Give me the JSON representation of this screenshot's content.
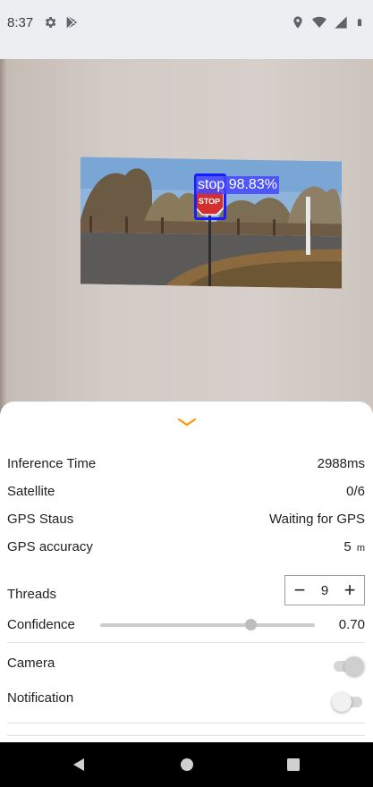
{
  "status_bar": {
    "time": "8:37",
    "left_icons": [
      "settings-icon",
      "play-store-icon"
    ],
    "right_icons": [
      "location-icon",
      "wifi-icon",
      "signal-icon",
      "battery-icon"
    ]
  },
  "camera": {
    "detection": {
      "label": "stop 98.83%",
      "color": "#1a1aff"
    },
    "sign_text": "STOP"
  },
  "sheet": {
    "collapse_icon": "chevron-down-icon",
    "accent": "#ff9800",
    "rows": {
      "inference": {
        "label": "Inference Time",
        "value": "2988ms"
      },
      "satellite": {
        "label": "Satellite",
        "value": "0/6"
      },
      "gps_status": {
        "label": "GPS Staus",
        "value": "Waiting for GPS"
      },
      "gps_accuracy": {
        "label": "GPS accuracy",
        "value": "5",
        "unit": "m"
      }
    },
    "threads": {
      "label": "Threads",
      "value": "9",
      "minus": "−",
      "plus": "+"
    },
    "confidence": {
      "label": "Confidence",
      "value": "0.70",
      "slider_fraction": 0.7
    },
    "camera": {
      "label": "Camera",
      "on": true
    },
    "notification": {
      "label": "Notification",
      "on": false
    }
  },
  "nav_bar": {
    "buttons": [
      "back-icon",
      "home-icon",
      "recents-icon"
    ]
  }
}
